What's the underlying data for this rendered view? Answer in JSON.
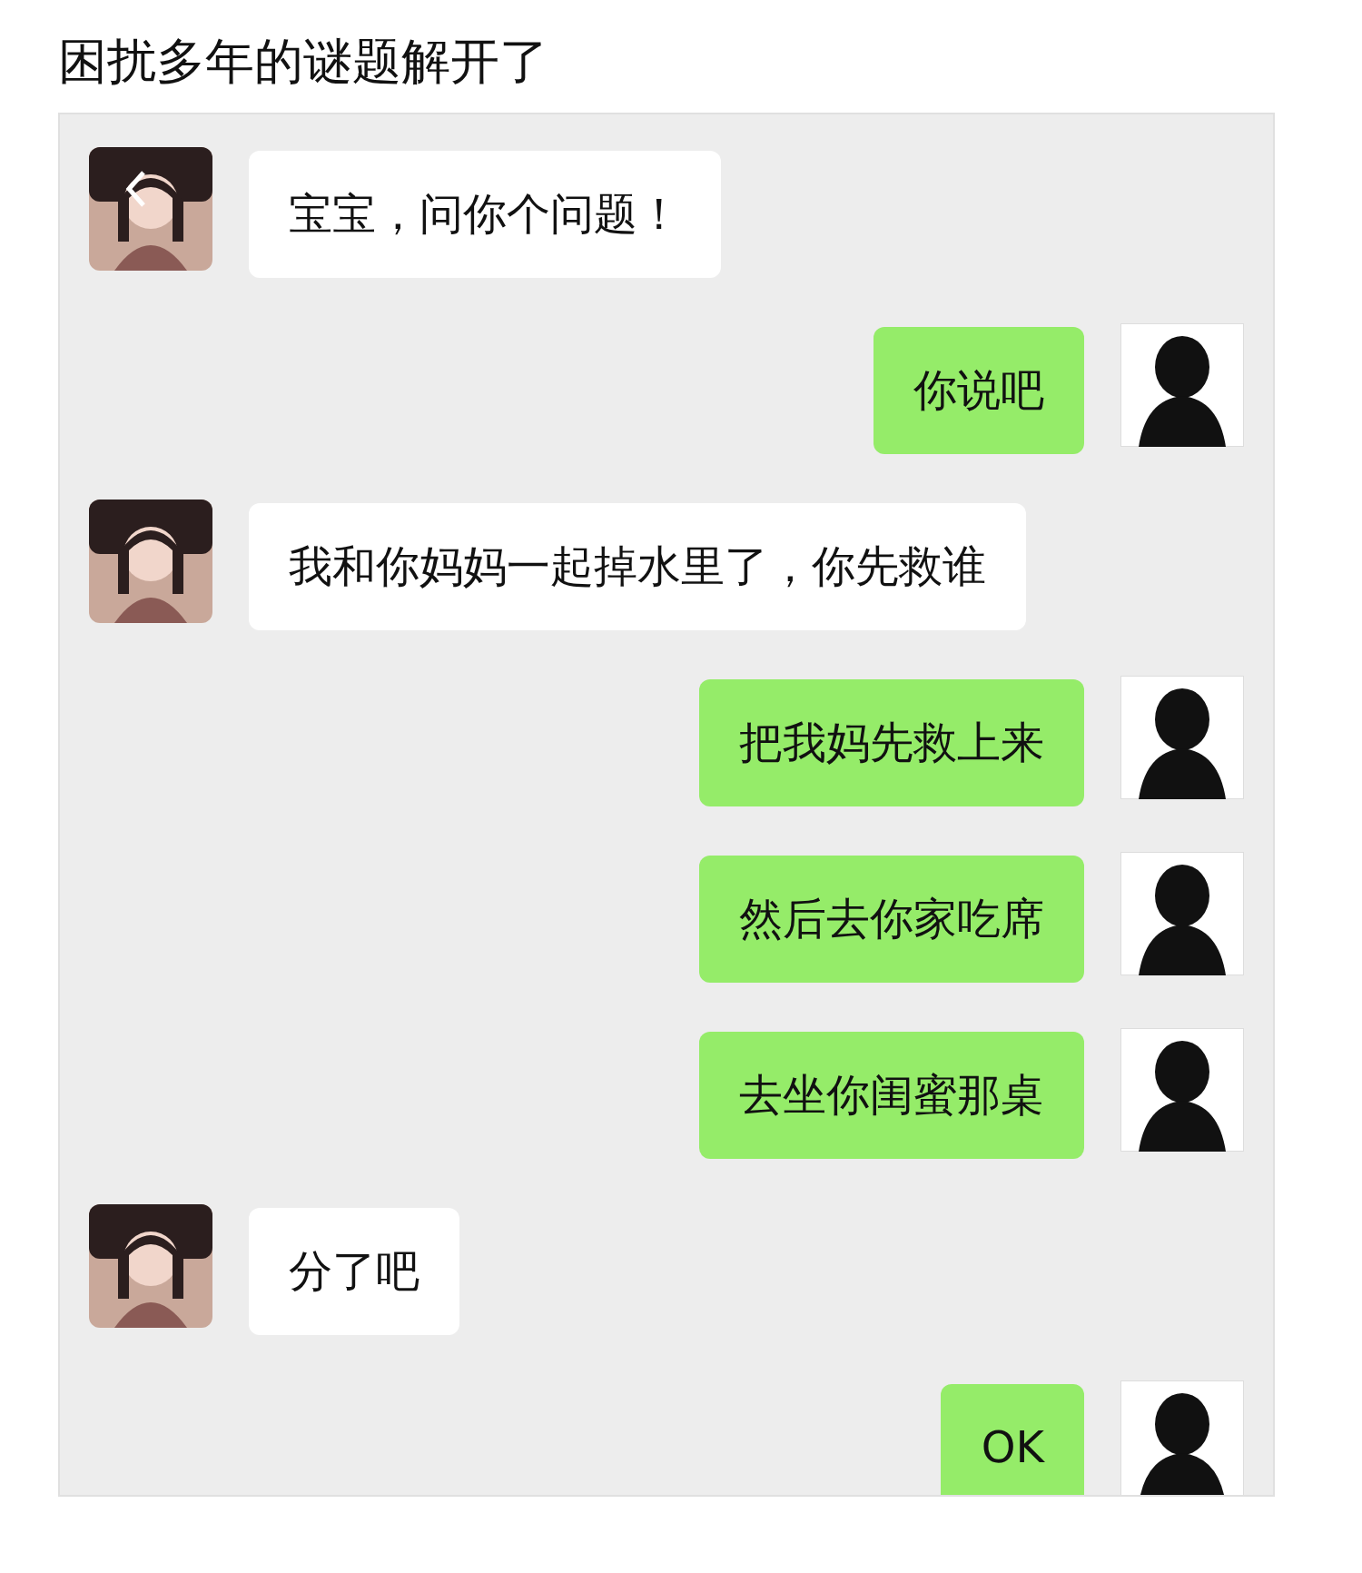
{
  "title": "困扰多年的谜题解开了",
  "messages": [
    {
      "kind": "received",
      "text": "宝宝，问你个问题！"
    },
    {
      "kind": "sent",
      "text": "你说吧"
    },
    {
      "kind": "received",
      "text": "我和你妈妈一起掉水里了，你先救谁"
    },
    {
      "kind": "sent",
      "text": "把我妈先救上来"
    },
    {
      "kind": "sent",
      "text": "然后去你家吃席"
    },
    {
      "kind": "sent",
      "text": "去坐你闺蜜那桌"
    },
    {
      "kind": "received",
      "text": "分了吧"
    },
    {
      "kind": "sent",
      "text": "OK"
    }
  ]
}
